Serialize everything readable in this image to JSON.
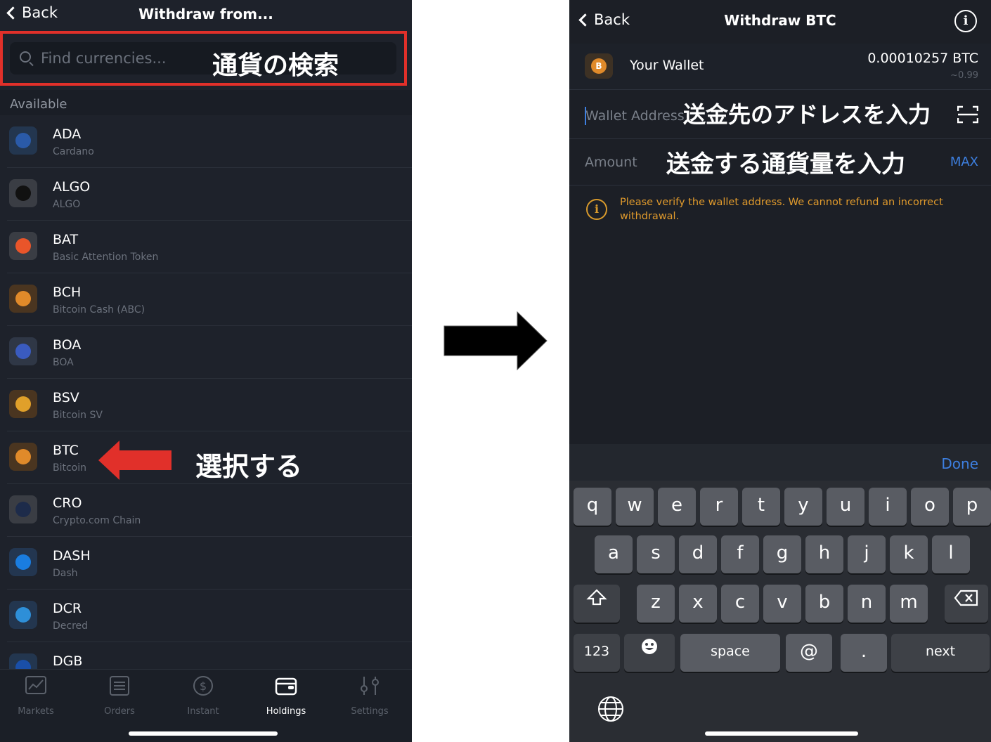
{
  "left": {
    "back_label": "Back",
    "title": "Withdraw from...",
    "search": {
      "placeholder": "Find currencies...",
      "note": "通貨の検索"
    },
    "section_label": "Available",
    "currencies": [
      {
        "symbol": "ADA",
        "name": "Cardano",
        "icon": "cardano-icon",
        "color": "#2a5aa8",
        "bg": "#23364f"
      },
      {
        "symbol": "ALGO",
        "name": "ALGO",
        "icon": "algo-icon",
        "color": "#111111",
        "bg": "#3a3d44"
      },
      {
        "symbol": "BAT",
        "name": "Basic Attention Token",
        "icon": "bat-icon",
        "color": "#e9552a",
        "bg": "#3a3d44"
      },
      {
        "symbol": "BCH",
        "name": "Bitcoin Cash (ABC)",
        "icon": "bitcoin-cash-icon",
        "color": "#e08a2a",
        "bg": "#4a3520"
      },
      {
        "symbol": "BOA",
        "name": "BOA",
        "icon": "boa-icon",
        "color": "#3a5bbf",
        "bg": "#2f3746"
      },
      {
        "symbol": "BSV",
        "name": "Bitcoin SV",
        "icon": "bitcoin-sv-icon",
        "color": "#e0a02a",
        "bg": "#4a3520"
      },
      {
        "symbol": "BTC",
        "name": "Bitcoin",
        "icon": "bitcoin-icon",
        "color": "#e08a2a",
        "bg": "#4a3520"
      },
      {
        "symbol": "CRO",
        "name": "Crypto.com Chain",
        "icon": "cro-icon",
        "color": "#1d2b4a",
        "bg": "#3a3d44"
      },
      {
        "symbol": "DASH",
        "name": "Dash",
        "icon": "dash-icon",
        "color": "#1a7de0",
        "bg": "#233650"
      },
      {
        "symbol": "DCR",
        "name": "Decred",
        "icon": "decred-icon",
        "color": "#2e8fd8",
        "bg": "#23364f"
      },
      {
        "symbol": "DGB",
        "name": "",
        "icon": "digibyte-icon",
        "color": "#1a4fa8",
        "bg": "#23364f"
      }
    ],
    "select_note": "選択する",
    "tabs": [
      {
        "label": "Markets",
        "icon": "chart-icon"
      },
      {
        "label": "Orders",
        "icon": "orders-icon"
      },
      {
        "label": "Instant",
        "icon": "dollar-icon"
      },
      {
        "label": "Holdings",
        "icon": "wallet-icon",
        "active": true
      },
      {
        "label": "Settings",
        "icon": "sliders-icon"
      }
    ]
  },
  "right": {
    "back_label": "Back",
    "title": "Withdraw BTC",
    "wallet": {
      "label": "Your Wallet",
      "balance": "0.00010257 BTC",
      "fiat": "~0.99"
    },
    "address_placeholder": "Wallet Address",
    "address_note": "送金先のアドレスを入力",
    "amount_placeholder": "Amount",
    "amount_note": "送金する通貨量を入力",
    "max_label": "MAX",
    "warning": "Please verify the wallet address. We cannot refund an incorrect withdrawal.",
    "done_label": "Done",
    "keyboard": {
      "row1": [
        "q",
        "w",
        "e",
        "r",
        "t",
        "y",
        "u",
        "i",
        "o",
        "p"
      ],
      "row2": [
        "a",
        "s",
        "d",
        "f",
        "g",
        "h",
        "j",
        "k",
        "l"
      ],
      "row3": [
        "z",
        "x",
        "c",
        "v",
        "b",
        "n",
        "m"
      ],
      "numbers": "123",
      "space": "space",
      "at": "@",
      "dot": ".",
      "next": "next"
    }
  },
  "colors": {
    "accent": "#3d7fe0",
    "warning": "#e09a2c",
    "highlight": "#e1302a"
  }
}
